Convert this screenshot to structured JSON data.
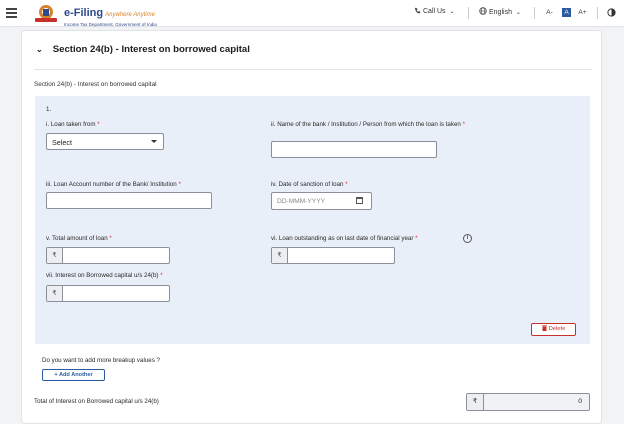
{
  "header": {
    "brand_name": "e-Filing",
    "brand_tagline": "Anywhere Anytime",
    "brand_subtitle": "Income Tax Department, Government of India",
    "call_us": "Call Us",
    "language": "English",
    "font_decrease": "A-",
    "font_normal": "A",
    "font_increase": "A+",
    "icons": [
      "menu-icon",
      "emblem-logo",
      "phone-icon",
      "globe-icon",
      "contrast-icon"
    ]
  },
  "section": {
    "title": "Section 24(b) - Interest on borrowed capital",
    "subtitle": "Section 24(b) - Interest on borrowed capital",
    "entry_number": "1.",
    "fields": {
      "loan_from_label": "i. Loan taken from",
      "loan_from_value": "Select",
      "bank_name_label": "ii. Name of the bank / Institution / Person from which the loan is taken",
      "account_no_label": "iii. Loan Account number of the Bank/ Institution",
      "sanction_date_label": "iv. Date of sanction of loan",
      "sanction_date_placeholder": "DD-MMM-YYYY",
      "total_loan_label": "v. Total amount of loan",
      "outstanding_label": "vi. Loan outstanding as on last date of financial year",
      "interest_label": "vii. Interest on Borrowed capital u/s 24(b)",
      "required_mark": "*",
      "currency_symbol": "₹",
      "info_symbol": "i"
    },
    "delete_label": "Delete",
    "add_more_question": "Do you want to add more breakup values ?",
    "add_another_label": "+ Add Another",
    "total_label": "Total of Interest on Borrowed capital u/s 24(b)",
    "total_value": "0"
  },
  "colors": {
    "brand_blue": "#2c4a8c",
    "accent_orange": "#d7832b",
    "panel_bg": "#e9eff8",
    "danger": "#c9302c",
    "primary_button": "#2c5aa0"
  }
}
